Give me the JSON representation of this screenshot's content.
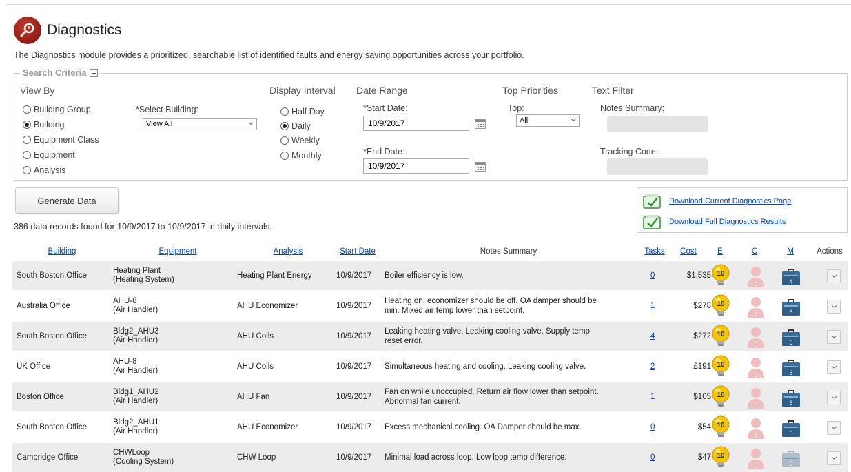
{
  "header": {
    "title": "Diagnostics",
    "logo_icon": "magnifier-icon"
  },
  "description": "The Diagnostics module provides a prioritized, searchable list of identified faults and energy saving opportunities across your portfolio.",
  "search_criteria": {
    "legend": "Search Criteria",
    "view_by": {
      "title": "View By",
      "options": [
        "Building Group",
        "Building",
        "Equipment Class",
        "Equipment",
        "Analysis"
      ],
      "selected": "Building"
    },
    "select_building": {
      "label": "*Select Building:",
      "value": "View All"
    },
    "display_interval": {
      "title": "Display Interval",
      "options": [
        "Half Day",
        "Daily",
        "Weekly",
        "Monthly"
      ],
      "selected": "Daily"
    },
    "date_range": {
      "title": "Date Range",
      "start_label": "*Start Date:",
      "start_value": "10/9/2017",
      "end_label": "*End Date:",
      "end_value": "10/9/2017"
    },
    "top_priorities": {
      "title": "Top Priorities",
      "top_label": "Top:",
      "top_value": "All"
    },
    "text_filter": {
      "title": "Text Filter",
      "notes_label": "Notes Summary:",
      "notes_value": "",
      "tracking_label": "Tracking Code:",
      "tracking_value": ""
    }
  },
  "generate_button": "Generate Data",
  "downloads": {
    "current": "Download Current Diagnostics Page",
    "full": "Download Full Diagnostics Results"
  },
  "records_summary": "386 data records found for 10/9/2017 to 10/9/2017 in daily intervals.",
  "table": {
    "headers": {
      "building": "Building",
      "equipment": "Equipment",
      "analysis": "Analysis",
      "start_date": "Start Date",
      "notes": "Notes Summary",
      "tasks": "Tasks",
      "cost": "Cost",
      "e": "E",
      "c": "C",
      "m": "M",
      "actions": "Actions"
    },
    "rows": [
      {
        "building": "South Boston Office",
        "equip_name": "Heating Plant",
        "equip_type": "(Heating System)",
        "analysis": "Heating Plant Energy",
        "date": "10/9/2017",
        "notes": "Boiler efficiency is low.",
        "tasks": "0",
        "cost": "$1,535",
        "e": "10",
        "c": "0",
        "m": "4"
      },
      {
        "building": "Australia Office",
        "equip_name": "AHU-8",
        "equip_type": "(Air Handler)",
        "analysis": "AHU Economizer",
        "date": "10/9/2017",
        "notes": "Heating on, economizer should be off. OA damper should be min. Mixed air temp lower than setpoint.",
        "tasks": "1",
        "cost": "$278",
        "e": "10",
        "c": "0",
        "m": "6"
      },
      {
        "building": "South Boston Office",
        "equip_name": "Bldg2_AHU3",
        "equip_type": "(Air Handler)",
        "analysis": "AHU Coils",
        "date": "10/9/2017",
        "notes": "Leaking heating valve. Leaking cooling valve. Supply temp reset error.",
        "tasks": "4",
        "cost": "$272",
        "e": "10",
        "c": "0",
        "m": "6"
      },
      {
        "building": "UK Office",
        "equip_name": "AHU-8",
        "equip_type": "(Air Handler)",
        "analysis": "AHU Coils",
        "date": "10/9/2017",
        "notes": "Simultaneous heating and cooling. Leaking cooling valve.",
        "tasks": "2",
        "cost": "£191",
        "e": "10",
        "c": "0",
        "m": "6"
      },
      {
        "building": "Boston Office",
        "equip_name": "Bldg1_AHU2",
        "equip_type": "(Air Handler)",
        "analysis": "AHU Fan",
        "date": "10/9/2017",
        "notes": "Fan on while unoccupied. Return air flow lower than setpoint. Abnormal fan current.",
        "tasks": "1",
        "cost": "$105",
        "e": "10",
        "c": "0",
        "m": "6"
      },
      {
        "building": "South Boston Office",
        "equip_name": "Bldg2_AHU1",
        "equip_type": "(Air Handler)",
        "analysis": "AHU Economizer",
        "date": "10/9/2017",
        "notes": "Excess mechanical cooling. OA Damper should be max.",
        "tasks": "0",
        "cost": "$54",
        "e": "10",
        "c": "0",
        "m": "6"
      },
      {
        "building": "Cambridge Office",
        "equip_name": "CHWLoop",
        "equip_type": "(Cooling System)",
        "analysis": "CHW Loop",
        "date": "10/9/2017",
        "notes": "Minimal load across loop. Low loop temp difference.",
        "tasks": "0",
        "cost": "$47",
        "e": "10",
        "c": "0",
        "m": "0"
      }
    ]
  },
  "colors": {
    "link": "#0044cc",
    "bulb": "#f5c400",
    "person": "#e8a8a8",
    "toolbox": "#2e5f8a",
    "logo": "#a01818"
  }
}
